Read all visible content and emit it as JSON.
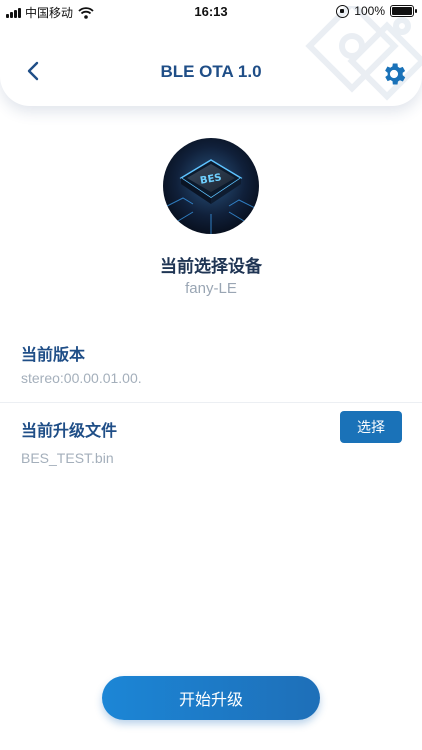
{
  "status_bar": {
    "carrier": "中国移动",
    "time": "16:13",
    "battery": "100%",
    "battery_level": 1.0
  },
  "header": {
    "title": "BLE OTA 1.0",
    "back_icon": "chevron-left-icon",
    "settings_icon": "gear-icon"
  },
  "device": {
    "heading": "当前选择设备",
    "name": "fany-LE",
    "chip_text": "BES"
  },
  "version": {
    "label": "当前版本",
    "value": "stereo:00.00.01.00."
  },
  "upgrade_file": {
    "label": "当前升级文件",
    "value": "BES_TEST.bin",
    "select_label": "选择"
  },
  "actions": {
    "start_label": "开始升级"
  },
  "colors": {
    "accent": "#1f4e87",
    "button": "#1a72b8",
    "muted_text": "#9aa6b4"
  }
}
